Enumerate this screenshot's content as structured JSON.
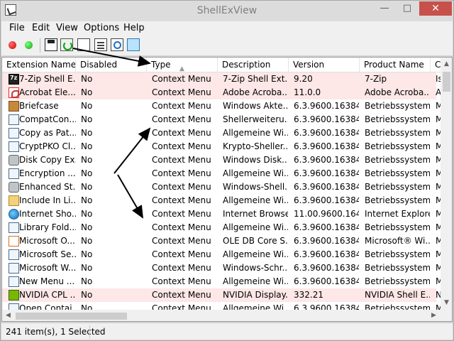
{
  "window": {
    "title": "ShellExView"
  },
  "menu": [
    "File",
    "Edit",
    "View",
    "Options",
    "Help"
  ],
  "columns": [
    "Extension Name",
    "Disabled",
    "Type",
    "Description",
    "Version",
    "Product Name",
    "C"
  ],
  "rows": [
    {
      "icon": "7zip-icon",
      "name": "7-Zip Shell E...",
      "disabled": "No",
      "type": "Context Menu",
      "desc": "7-Zip Shell Ext...",
      "ver": "9.20",
      "prod": "7-Zip",
      "extra": "Is",
      "hl": true
    },
    {
      "icon": "acrobat-icon",
      "name": "Acrobat Ele...",
      "disabled": "No",
      "type": "Context Menu",
      "desc": "Adobe Acroba...",
      "ver": "11.0.0",
      "prod": "Adobe Acroba...",
      "extra": "A",
      "hl": true
    },
    {
      "icon": "briefcase-icon",
      "name": "Briefcase",
      "disabled": "No",
      "type": "Context Menu",
      "desc": "Windows Akte...",
      "ver": "6.3.9600.16384 ...",
      "prod": "Betriebssystem...",
      "extra": "M",
      "hl": false
    },
    {
      "icon": "dll-icon",
      "name": "CompatCon...",
      "disabled": "No",
      "type": "Context Menu",
      "desc": "Shellerweiteru...",
      "ver": "6.3.9600.16384 ...",
      "prod": "Betriebssystem...",
      "extra": "M",
      "hl": false
    },
    {
      "icon": "dll-icon",
      "name": "Copy as Pat...",
      "disabled": "No",
      "type": "Context Menu",
      "desc": "Allgemeine Wi...",
      "ver": "6.3.9600.16384 ...",
      "prod": "Betriebssystem...",
      "extra": "M",
      "hl": false
    },
    {
      "icon": "dll-icon",
      "name": "CryptPKO Cl...",
      "disabled": "No",
      "type": "Context Menu",
      "desc": "Krypto-Sheller...",
      "ver": "6.3.9600.16384 ...",
      "prod": "Betriebssystem...",
      "extra": "M",
      "hl": false
    },
    {
      "icon": "disk-icon",
      "name": "Disk Copy Ex...",
      "disabled": "No",
      "type": "Context Menu",
      "desc": "Windows Disk...",
      "ver": "6.3.9600.16384 ...",
      "prod": "Betriebssystem...",
      "extra": "M",
      "hl": false
    },
    {
      "icon": "dll-icon",
      "name": "Encryption ...",
      "disabled": "No",
      "type": "Context Menu",
      "desc": "Allgemeine Wi...",
      "ver": "6.3.9600.16384 ...",
      "prod": "Betriebssystem...",
      "extra": "M",
      "hl": false
    },
    {
      "icon": "disk-icon",
      "name": "Enhanced St...",
      "disabled": "No",
      "type": "Context Menu",
      "desc": "Windows-Shell...",
      "ver": "6.3.9600.16384 ...",
      "prod": "Betriebssystem...",
      "extra": "M",
      "hl": false
    },
    {
      "icon": "folder-icon",
      "name": "Include In Li...",
      "disabled": "No",
      "type": "Context Menu",
      "desc": "Allgemeine Wi...",
      "ver": "6.3.9600.16384 ...",
      "prod": "Betriebssystem...",
      "extra": "M",
      "hl": false
    },
    {
      "icon": "globe-icon",
      "name": "Internet Sho...",
      "disabled": "No",
      "type": "Context Menu",
      "desc": "Internet Browser",
      "ver": "11.00.9600.164...",
      "prod": "Internet Explorer",
      "extra": "M",
      "hl": false
    },
    {
      "icon": "dll-icon",
      "name": "Library Fold...",
      "disabled": "No",
      "type": "Context Menu",
      "desc": "Allgemeine Wi...",
      "ver": "6.3.9600.16384 ...",
      "prod": "Betriebssystem...",
      "extra": "M",
      "hl": false
    },
    {
      "icon": "office-icon",
      "name": "Microsoft O...",
      "disabled": "No",
      "type": "Context Menu",
      "desc": "OLE DB Core S...",
      "ver": "6.3.9600.16384 ...",
      "prod": "Microsoft® Wi...",
      "extra": "M",
      "hl": false
    },
    {
      "icon": "dll-icon",
      "name": "Microsoft Se...",
      "disabled": "No",
      "type": "Context Menu",
      "desc": "Allgemeine Wi...",
      "ver": "6.3.9600.16384 ...",
      "prod": "Betriebssystem...",
      "extra": "M",
      "hl": false
    },
    {
      "icon": "dll-icon",
      "name": "Microsoft W...",
      "disabled": "No",
      "type": "Context Menu",
      "desc": "Windows-Schr...",
      "ver": "6.3.9600.16384 ...",
      "prod": "Betriebssystem...",
      "extra": "M",
      "hl": false
    },
    {
      "icon": "dll-icon",
      "name": "New Menu ...",
      "disabled": "No",
      "type": "Context Menu",
      "desc": "Allgemeine Wi...",
      "ver": "6.3.9600.16384 ...",
      "prod": "Betriebssystem...",
      "extra": "M",
      "hl": false
    },
    {
      "icon": "nvidia-icon",
      "name": "NVIDIA CPL ...",
      "disabled": "No",
      "type": "Context Menu",
      "desc": "NVIDIA Display...",
      "ver": "332.21",
      "prod": "NVIDIA Shell E...",
      "extra": "N",
      "hl": true
    },
    {
      "icon": "dll-icon",
      "name": "Open Contai...",
      "disabled": "No",
      "type": "Context Menu",
      "desc": "Allgemeine Wi...",
      "ver": "6.3.9600.16384 ...",
      "prod": "Betriebssystem...",
      "extra": "M",
      "hl": false
    }
  ],
  "status": {
    "text": "241 item(s), 1 Selected"
  }
}
